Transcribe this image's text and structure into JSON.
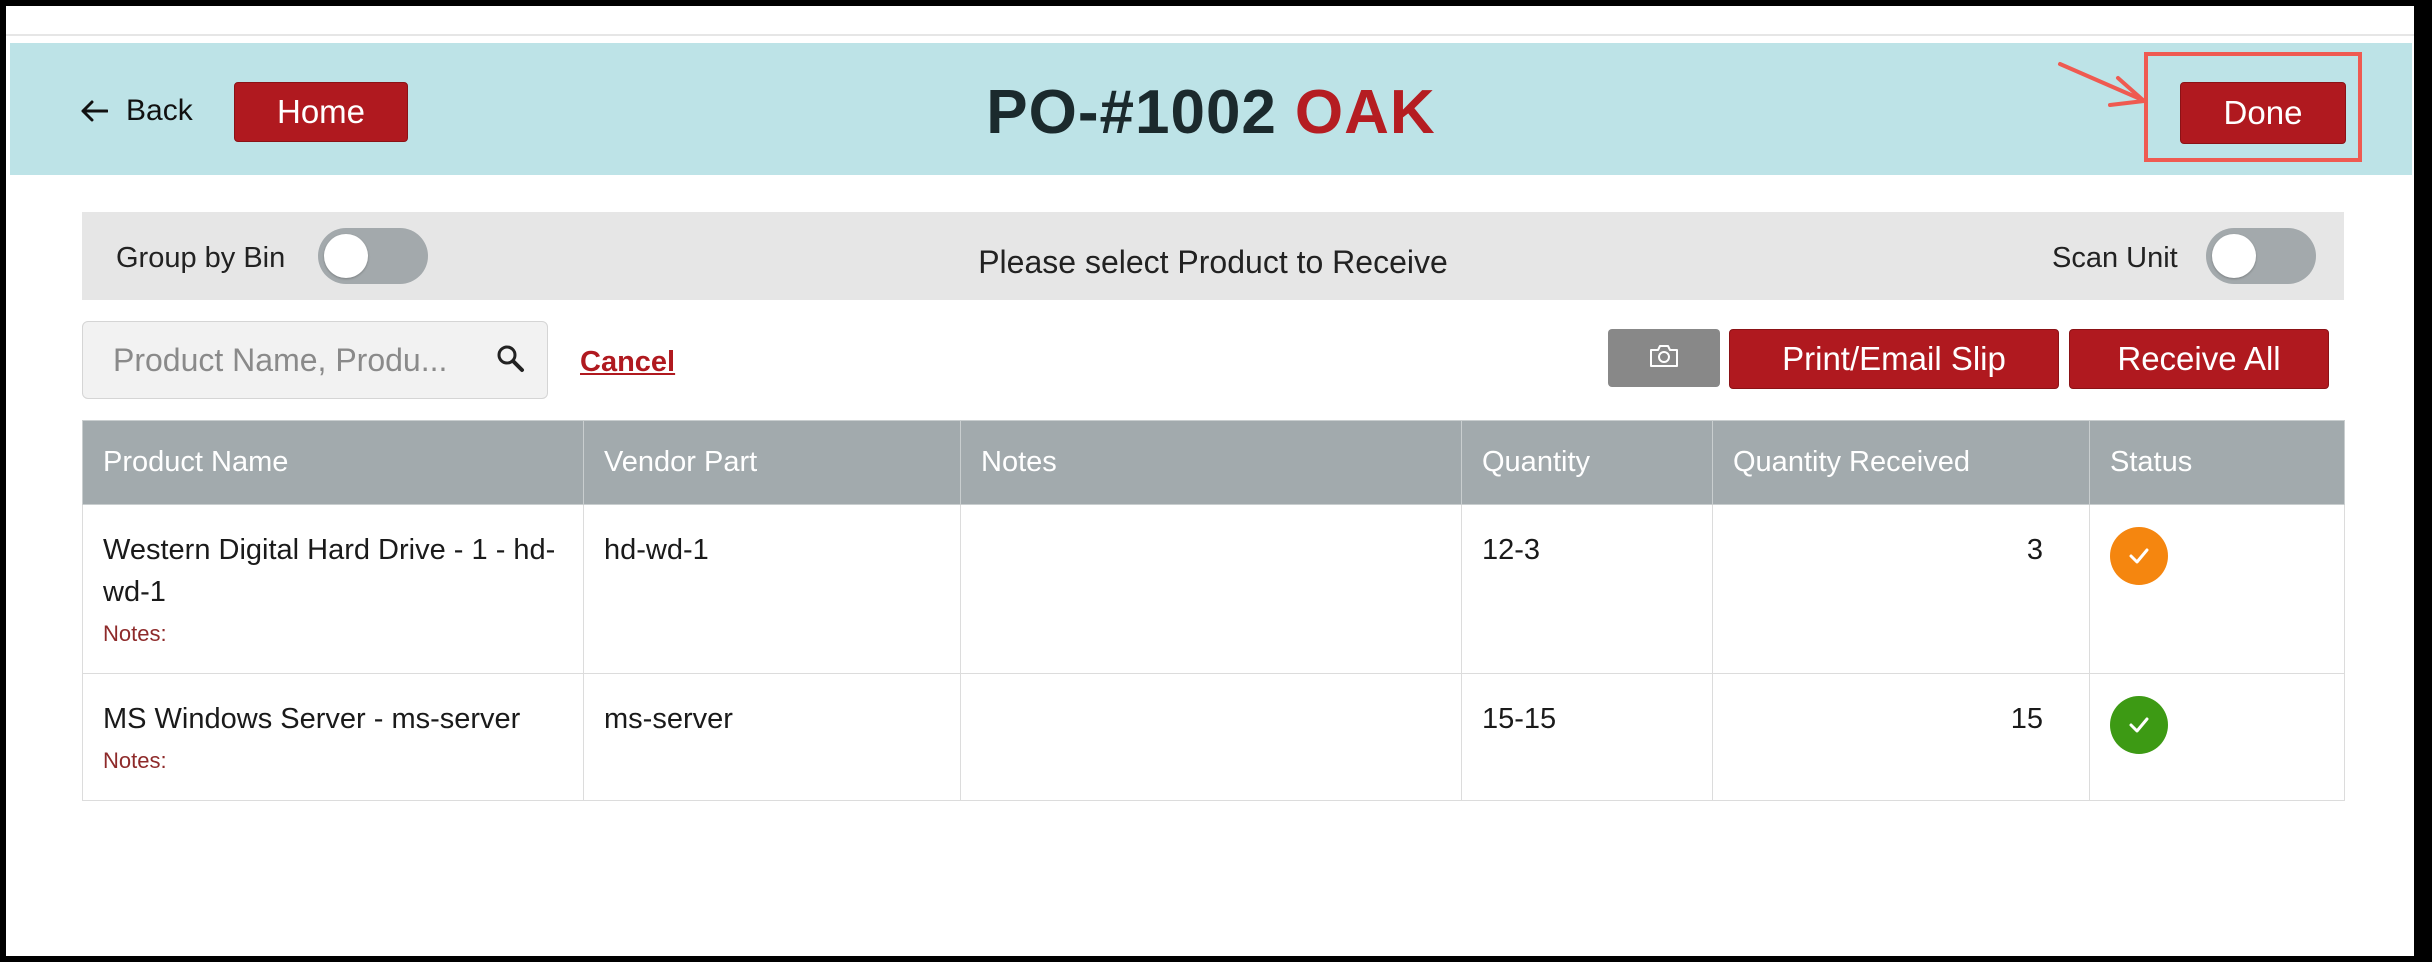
{
  "header": {
    "back_label": "Back",
    "home_label": "Home",
    "po_number": "PO-#1002",
    "location": "OAK",
    "done_label": "Done"
  },
  "toolbar": {
    "group_by_bin_label": "Group by Bin",
    "group_by_bin_on": false,
    "message": "Please select Product to Receive",
    "scan_unit_label": "Scan Unit",
    "scan_unit_on": false
  },
  "search": {
    "placeholder": "Product Name, Produ...",
    "cancel_label": "Cancel"
  },
  "actions": {
    "camera_icon": "camera-icon",
    "print_label": "Print/Email Slip",
    "receive_all_label": "Receive All"
  },
  "table": {
    "columns": [
      "Product Name",
      "Vendor Part",
      "Notes",
      "Quantity",
      "Quantity Received",
      "Status"
    ],
    "rows": [
      {
        "product_name": "Western Digital Hard Drive - 1 - hd-wd-1",
        "notes_label": "Notes:",
        "vendor_part": "hd-wd-1",
        "notes": "",
        "quantity": "12-3",
        "received": "3",
        "status": "partial",
        "status_color": "#f5860f"
      },
      {
        "product_name": "MS Windows Server - ms-server",
        "notes_label": "Notes:",
        "vendor_part": "ms-server",
        "notes": "",
        "quantity": "15-15",
        "received": "15",
        "status": "complete",
        "status_color": "#3d9a14"
      }
    ]
  },
  "colors": {
    "accent_red": "#b0191f",
    "header_bg": "#bde3e7",
    "table_header_bg": "#a2aaad",
    "annotation": "#ef5a51"
  }
}
